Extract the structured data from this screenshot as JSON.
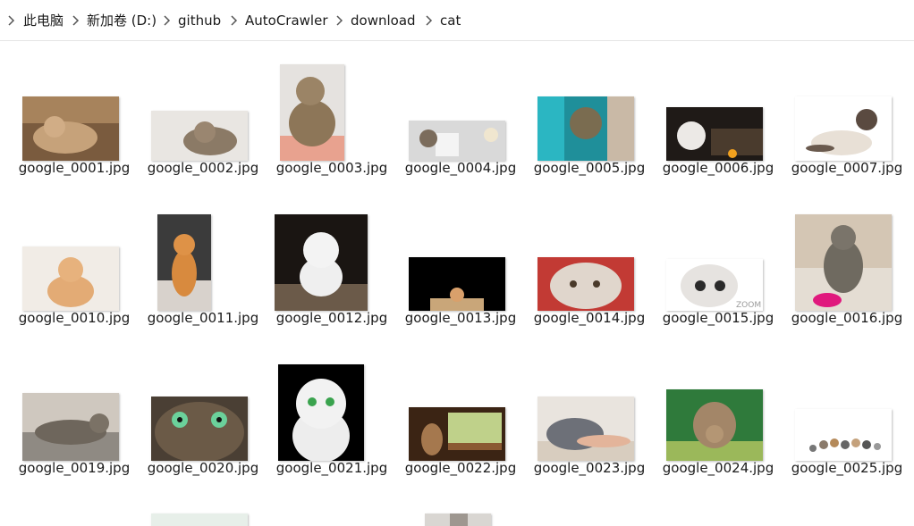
{
  "breadcrumb": [
    {
      "label": "此电脑"
    },
    {
      "label": "新加卷 (D:)"
    },
    {
      "label": "github"
    },
    {
      "label": "AutoCrawler"
    },
    {
      "label": "download"
    },
    {
      "label": "cat"
    }
  ],
  "files": [
    {
      "name": "google_0001.jpg",
      "icon": "image-thumbnail"
    },
    {
      "name": "google_0002.jpg",
      "icon": "image-thumbnail"
    },
    {
      "name": "google_0003.jpg",
      "icon": "image-thumbnail"
    },
    {
      "name": "google_0004.jpg",
      "icon": "image-thumbnail"
    },
    {
      "name": "google_0005.jpg",
      "icon": "image-thumbnail"
    },
    {
      "name": "google_0006.jpg",
      "icon": "image-thumbnail"
    },
    {
      "name": "google_0007.jpg",
      "icon": "image-thumbnail"
    },
    {
      "name": "google_0010.jpg",
      "icon": "image-thumbnail"
    },
    {
      "name": "google_0011.jpg",
      "icon": "image-thumbnail"
    },
    {
      "name": "google_0012.jpg",
      "icon": "image-thumbnail"
    },
    {
      "name": "google_0013.jpg",
      "icon": "image-thumbnail"
    },
    {
      "name": "google_0014.jpg",
      "icon": "image-thumbnail"
    },
    {
      "name": "google_0015.jpg",
      "icon": "image-thumbnail"
    },
    {
      "name": "google_0016.jpg",
      "icon": "image-thumbnail"
    },
    {
      "name": "google_0019.jpg",
      "icon": "image-thumbnail"
    },
    {
      "name": "google_0020.jpg",
      "icon": "image-thumbnail"
    },
    {
      "name": "google_0021.jpg",
      "icon": "image-thumbnail"
    },
    {
      "name": "google_0022.jpg",
      "icon": "image-thumbnail"
    },
    {
      "name": "google_0023.jpg",
      "icon": "image-thumbnail"
    },
    {
      "name": "google_0024.jpg",
      "icon": "image-thumbnail"
    },
    {
      "name": "google_0025.jpg",
      "icon": "image-thumbnail"
    }
  ],
  "thumbnail_watermark": "ZOOM",
  "colors": {
    "text": "#1a1a1a",
    "chevron": "#555555",
    "divider": "#e5e5e5"
  }
}
